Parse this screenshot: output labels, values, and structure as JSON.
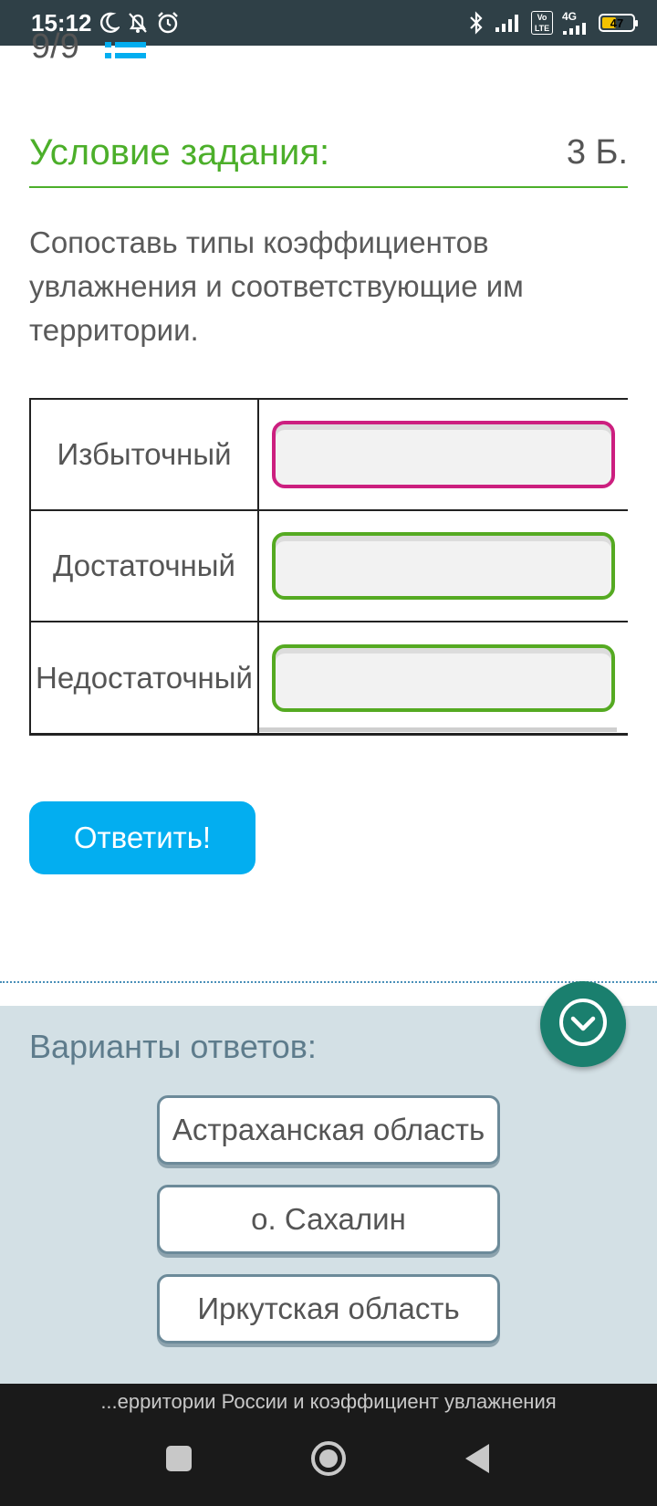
{
  "status_bar": {
    "time": "15:12",
    "network_label": "4G",
    "volte_label": "Vo LTE",
    "battery_level": "47"
  },
  "page": {
    "counter": "9/9"
  },
  "task": {
    "title": "Условие задания:",
    "score": "3 Б.",
    "text": "Сопоставь типы коэффициентов увлажнения и соответствующие им территории."
  },
  "matching": {
    "rows": [
      {
        "label": "Избыточный"
      },
      {
        "label": "Достаточный"
      },
      {
        "label": "Недостаточный"
      }
    ]
  },
  "answer_button": {
    "label": "Ответить!"
  },
  "options": {
    "title": "Варианты ответов:",
    "items": [
      {
        "label": "Астраханская область"
      },
      {
        "label": "о. Сахалин"
      },
      {
        "label": "Иркутская область"
      }
    ]
  },
  "bottom_caption": "...ерритории России и коэффициент увлажнения",
  "colors": {
    "accent_green": "#4caf2a",
    "active_pink": "#cc1f7f",
    "button_blue": "#03aef0",
    "fab_teal": "#1a7f6e",
    "panel_bg": "#d3e0e5"
  }
}
